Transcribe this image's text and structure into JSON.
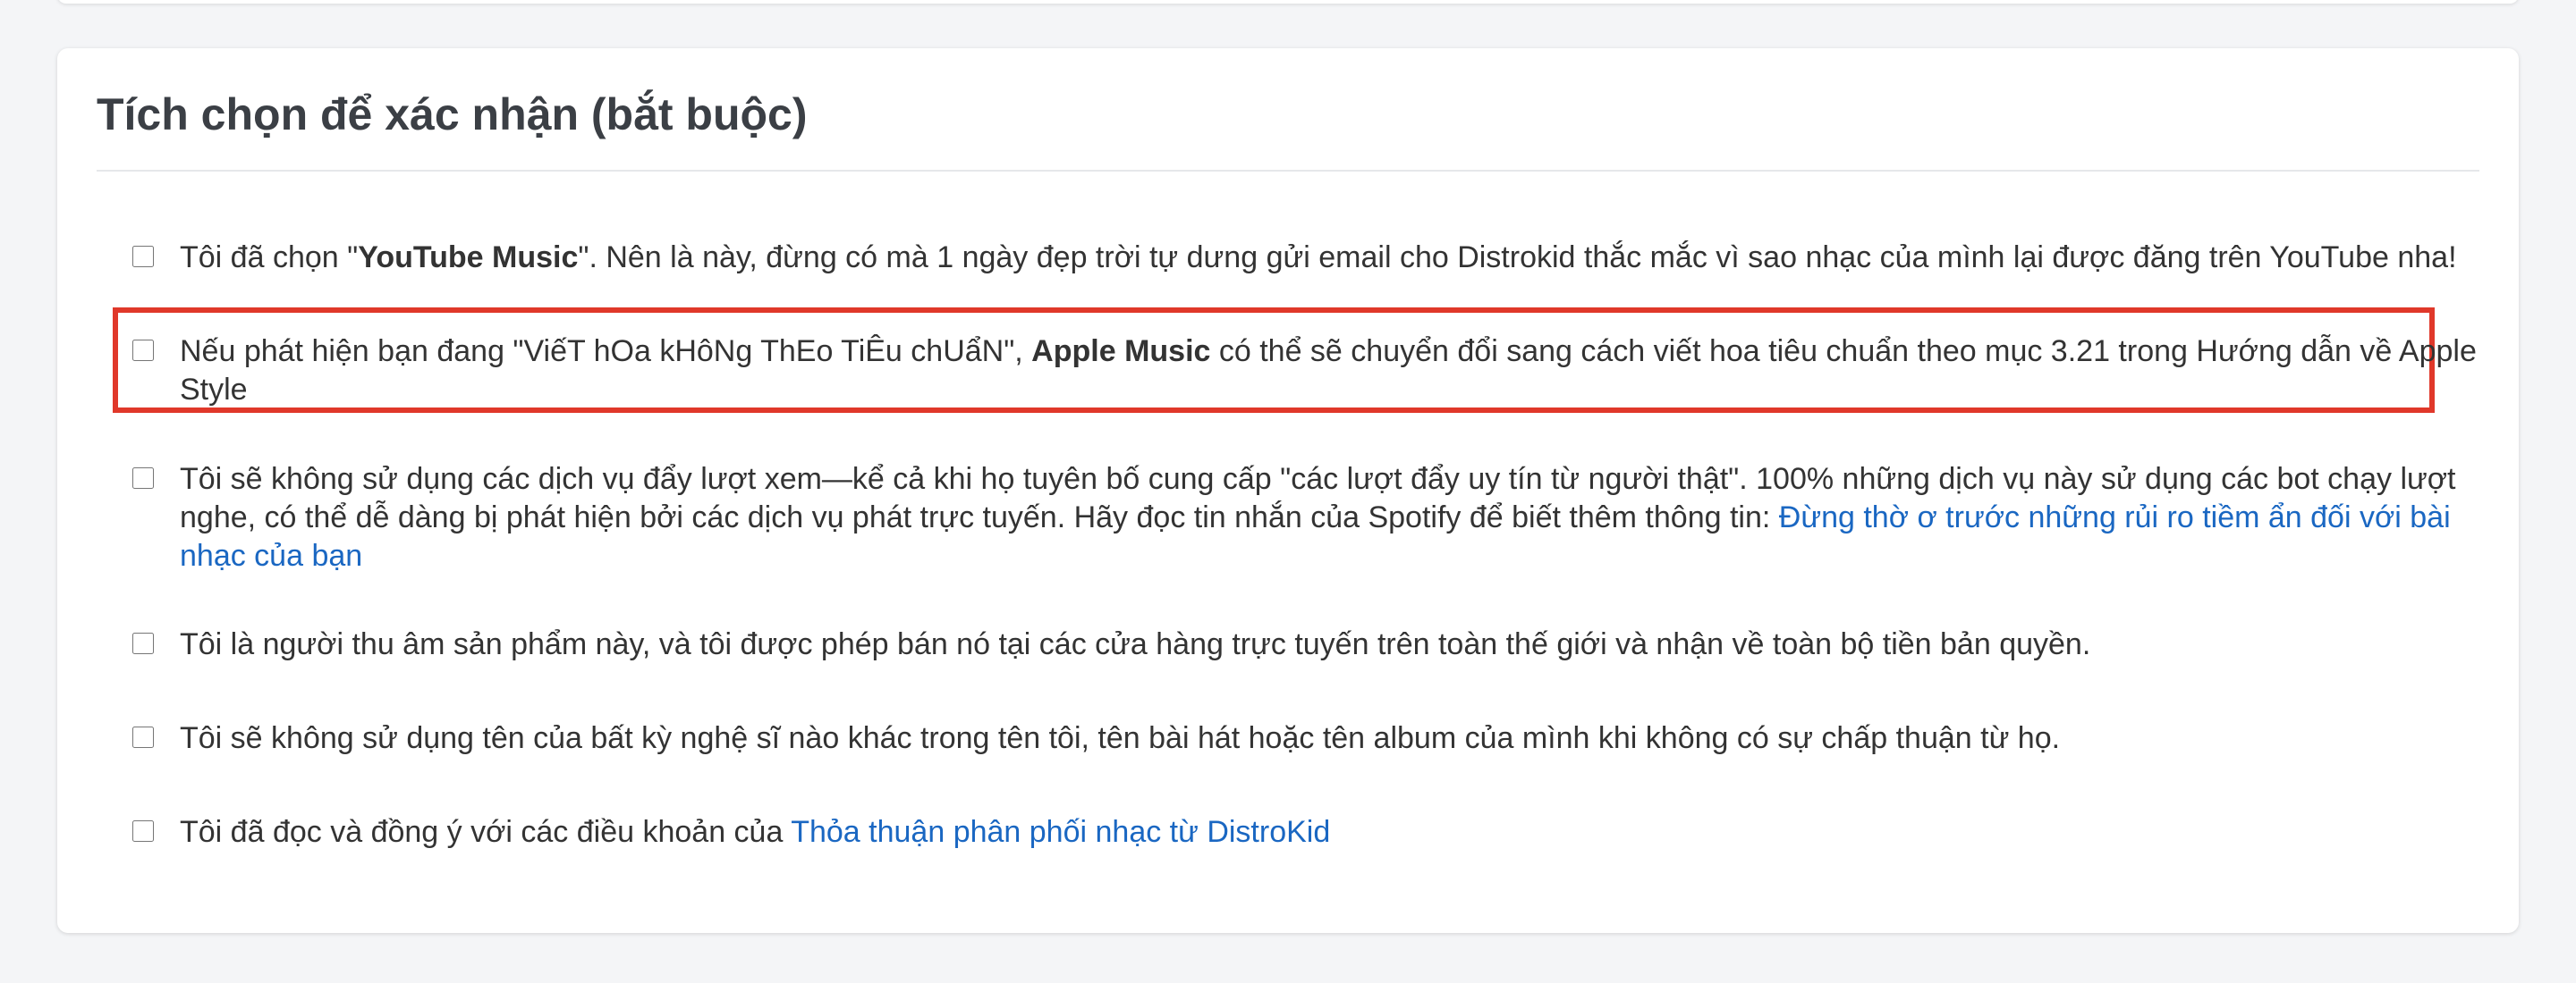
{
  "section": {
    "title": "Tích chọn để xác nhận (bắt buộc)"
  },
  "items": [
    {
      "pre": "Tôi đã chọn \"",
      "bold": "YouTube Music",
      "post": "\". Nên là này, đừng có mà 1 ngày đẹp trời tự dưng gửi email cho Distrokid thắc mắc vì sao nhạc của mình lại được đăng trên YouTube nha!",
      "checked": false
    },
    {
      "pre": "Nếu phát hiện bạn đang \"ViếT hOa kHôNg ThEo TiÊu chUẩN\", ",
      "bold": "Apple Music",
      "post": " có thể sẽ chuyển đổi sang cách viết hoa tiêu chuẩn theo mục 3.21 trong Hướng dẫn về Apple Style",
      "checked": false,
      "highlighted": true
    },
    {
      "pre": "Tôi sẽ không sử dụng các dịch vụ đẩy lượt xem—kể cả khi họ tuyên bố cung cấp \"các lượt đẩy uy tín từ người thật\". 100% những dịch vụ này sử dụng các bot chạy lượt nghe, có thể dễ dàng bị phát hiện bởi các dịch vụ phát trực tuyến. Hãy đọc tin nhắn của Spotify để biết thêm thông tin: ",
      "link": "Đừng thờ ơ trước những rủi ro tiềm ẩn đối với bài nhạc của bạn",
      "checked": false
    },
    {
      "pre": "Tôi là người thu âm sản phẩm này, và tôi được phép bán nó tại các cửa hàng trực tuyến trên toàn thế giới và nhận về toàn bộ tiền bản quyền.",
      "checked": false
    },
    {
      "pre": "Tôi sẽ không sử dụng tên của bất kỳ nghệ sĩ nào khác trong tên tôi, tên bài hát hoặc tên album của mình khi không có sự chấp thuận từ họ.",
      "checked": false
    },
    {
      "pre": "Tôi đã đọc và đồng ý với các điều khoản của ",
      "link": "Thỏa thuận phân phối nhạc từ DistroKid",
      "checked": false
    }
  ],
  "colors": {
    "highlight_border": "#e0382a",
    "link": "#1a67c2",
    "title": "#3b3f45"
  }
}
